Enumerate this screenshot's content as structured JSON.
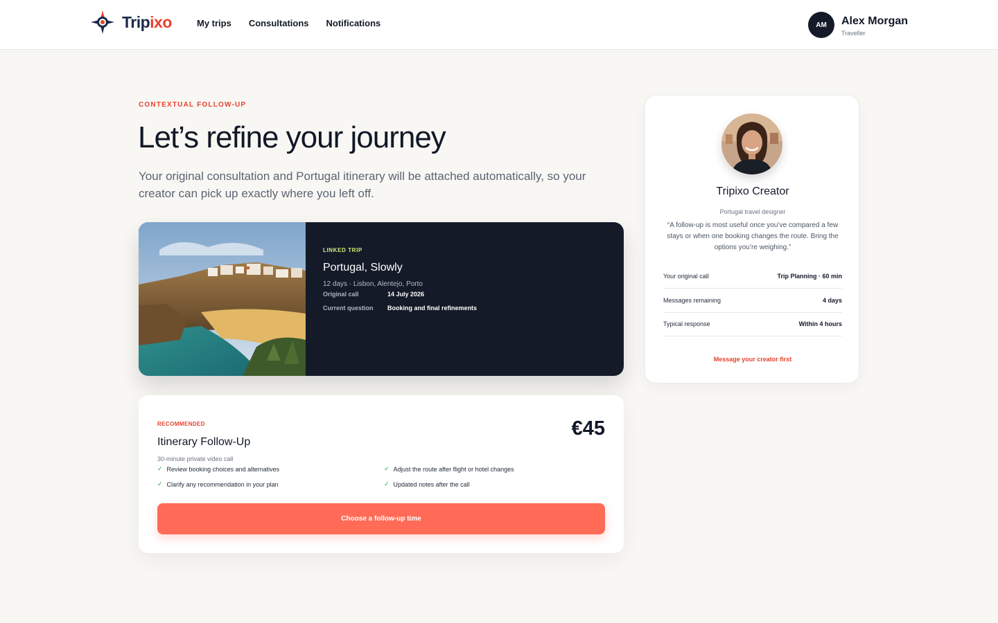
{
  "brand": {
    "name_main": "Trip",
    "name_accent": "ixo",
    "logo_icon": "compass-pin-icon",
    "accent_color": "#e8412c",
    "navy_color": "#1b2a4a"
  },
  "nav": {
    "items": [
      {
        "label": "My trips"
      },
      {
        "label": "Consultations"
      },
      {
        "label": "Notifications"
      }
    ]
  },
  "user": {
    "initials": "AM",
    "name": "Alex Morgan",
    "role": "Traveller"
  },
  "hero": {
    "eyebrow": "CONTEXTUAL FOLLOW-UP",
    "title": "Let’s refine your journey",
    "intro": "Your original consultation and Portugal itinerary will be attached automatically, so your creator can pick up exactly where you left off."
  },
  "trip": {
    "label": "LINKED TRIP",
    "name": "Portugal, Slowly",
    "summary": "12 days · Lisbon, Alentejo, Porto",
    "original_call_label": "Original call",
    "original_call_value": "14 July 2026",
    "current_question_label": "Current question",
    "current_question_value": "Booking and final refinements"
  },
  "offer": {
    "badge": "RECOMMENDED",
    "title": "Itinerary Follow-Up",
    "price": "€45",
    "subtitle": "30-minute private video call",
    "features": [
      "Review booking choices and alternatives",
      "Adjust the route after flight or hotel changes",
      "Clarify any recommendation in your plan",
      "Updated notes after the call"
    ],
    "cta": "Choose a follow-up time",
    "check_color": "#16a34a",
    "cta_color": "#ff6b57"
  },
  "creator": {
    "name": "Tripixo Creator",
    "role": "Portugal travel designer",
    "quote": "“A follow-up is most useful once you’ve compared a few stays or when one booking changes the route. Bring the options you’re weighing.”",
    "stats": [
      {
        "label": "Your original call",
        "value": "Trip Planning · 60 min"
      },
      {
        "label": "Messages remaining",
        "value": "4 days"
      },
      {
        "label": "Typical response",
        "value": "Within 4 hours"
      }
    ],
    "message_link": "Message your creator first"
  }
}
